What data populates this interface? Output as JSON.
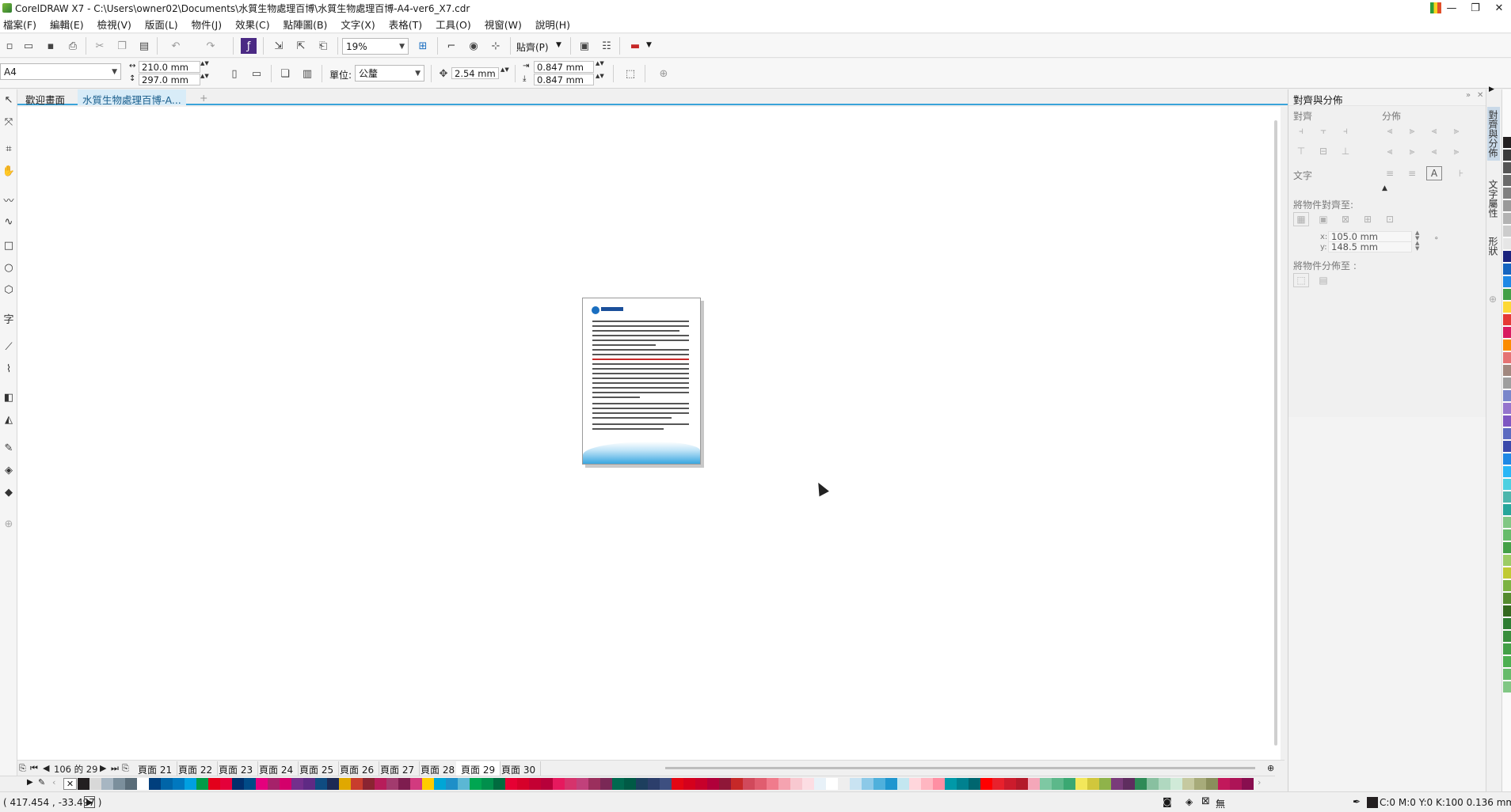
{
  "window": {
    "title": "CorelDRAW X7 - C:\\Users\\owner02\\Documents\\水質生物處理百博\\水質生物處理百博-A4-ver6_X7.cdr",
    "minimize": "—",
    "restore": "❐",
    "close": "✕"
  },
  "menu": [
    "檔案(F)",
    "編輯(E)",
    "檢視(V)",
    "版面(L)",
    "物件(J)",
    "效果(C)",
    "點陣圖(B)",
    "文字(X)",
    "表格(T)",
    "工具(O)",
    "視窗(W)",
    "說明(H)"
  ],
  "toolbar": {
    "zoom": "19%",
    "snap_label": "貼齊(P)"
  },
  "property_bar": {
    "page_size": "A4",
    "width": "210.0 mm",
    "height": "297.0 mm",
    "units_label": "單位:",
    "units_value": "公釐",
    "nudge": "2.54 mm",
    "dup_x": "0.847 mm",
    "dup_y": "0.847 mm"
  },
  "doc_tabs": [
    "歡迎畫面",
    "水質生物處理百博-A..."
  ],
  "page_nav": {
    "counter": "106 的 29",
    "pages": [
      "頁面 21",
      "頁面 22",
      "頁面 23",
      "頁面 24",
      "頁面 25",
      "頁面 26",
      "頁面 27",
      "頁面 28",
      "頁面 29",
      "頁面 30"
    ],
    "active": "頁面 29"
  },
  "status": {
    "coords": "( 417.454 , -33.497 )",
    "fill_info": "C:0 M:0 Y:0 K:100  0.136 mm",
    "none_label": "無"
  },
  "docker": {
    "title": "對齊與分佈",
    "align_label": "對齊",
    "distribute_label": "分佈",
    "text_label": "文字",
    "align_to_label": "將物件對齊至:",
    "x_label": "x:",
    "x_value": "105.0 mm",
    "y_label": "y:",
    "y_value": "148.5 mm",
    "distribute_to_label": "將物件分佈至 :"
  },
  "side_tabs": [
    "對齊與分佈",
    "文字屬性",
    "形狀"
  ],
  "palette_colors": [
    "#231f20",
    "#d8d8d8",
    "#a7b6c2",
    "#7b8f9c",
    "#5a6d79",
    "#ffffff",
    "#003f7d",
    "#0065a8",
    "#0078bf",
    "#00a0e1",
    "#009b48",
    "#e3001b",
    "#e4003a",
    "#002f6c",
    "#004b87",
    "#e4007d",
    "#a6226a",
    "#d4006b",
    "#742f8c",
    "#5f2a84",
    "#0f4c81",
    "#1d2a54",
    "#e0a800",
    "#c83d2d",
    "#8a2432",
    "#b71c5a",
    "#a23b6e",
    "#7e1d4f",
    "#d23a7f",
    "#ffcc00",
    "#00a6d6",
    "#1e8fc8",
    "#5bb7d4",
    "#00a651",
    "#008f4c",
    "#006b3f",
    "#e60033",
    "#d6002a",
    "#c40033",
    "#b7003a",
    "#e6195e",
    "#d6336c",
    "#c1417b",
    "#9b2f5d",
    "#7a2856",
    "#00694f",
    "#005a45",
    "#1d3f5e",
    "#2c3e6b",
    "#3d4f80",
    "#e30613",
    "#d5001c",
    "#c7002a",
    "#b1003a",
    "#8f1738",
    "#c62828",
    "#d1495b",
    "#e05d6f",
    "#f07b8c",
    "#f5a3b0",
    "#f8c8d0",
    "#fcdde3",
    "#e8f1f8",
    "#ffffff",
    "#eeeeee",
    "#c9e3f2",
    "#8cc9e8",
    "#4fb0dc",
    "#1f96cf",
    "#c3e6f0",
    "#ffd6dc",
    "#ffb6c1",
    "#ff8fa3",
    "#0099a8",
    "#00818f",
    "#00666f",
    "#ff0000",
    "#e8212c",
    "#cc1b2c",
    "#b3192a",
    "#f4a7b9",
    "#7ec8a3",
    "#5cb88a",
    "#3aa872",
    "#f2e75a",
    "#d1c73c",
    "#8fb34a",
    "#7a3b7a",
    "#5f2d5f",
    "#2e8b57",
    "#88c0a0",
    "#b0d8c0",
    "#d0ead8",
    "#c5c9a0",
    "#a7ab7a",
    "#8a8e5c",
    "#c2185b",
    "#ad1457",
    "#880e4f",
    "#e91e63",
    "#d81b60",
    "#c2185b"
  ],
  "strip_colors": [
    "#231f20",
    "#3a3a3a",
    "#555555",
    "#6b6b6b",
    "#808080",
    "#999999",
    "#b3b3b3",
    "#cccccc",
    "#e6e6e6",
    "#1a237e",
    "#1565c0",
    "#1e88e5",
    "#43a047",
    "#fdd835",
    "#e53935",
    "#d81b60",
    "#fb8c00",
    "#e57373",
    "#a1887f",
    "#9e9e9e",
    "#7986cb",
    "#9575cd",
    "#7e57c2",
    "#5c6bc0",
    "#3949ab",
    "#1e88e5",
    "#29b6f6",
    "#4dd0e1",
    "#4db6ac",
    "#26a69a",
    "#81c784",
    "#66bb6a",
    "#43a047",
    "#9ccc65",
    "#c0ca33",
    "#7cb342",
    "#558b2f",
    "#33691e",
    "#2e7d32",
    "#388e3c",
    "#43a047",
    "#4caf50",
    "#66bb6a",
    "#81c784"
  ]
}
